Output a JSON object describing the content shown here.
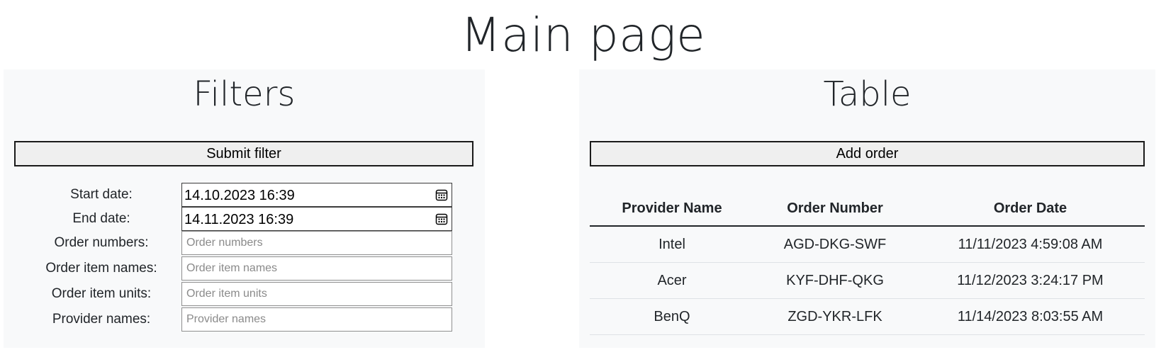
{
  "page": {
    "title": "Main page"
  },
  "filters": {
    "title": "Filters",
    "submit_label": "Submit filter",
    "start_date": {
      "label": "Start date:",
      "value": "14.10.2023 16:39"
    },
    "end_date": {
      "label": "End date:",
      "value": "14.11.2023 16:39"
    },
    "order_numbers": {
      "label": "Order numbers:",
      "placeholder": "Order numbers"
    },
    "order_item_names": {
      "label": "Order item names:",
      "placeholder": "Order item names"
    },
    "order_item_units": {
      "label": "Order item units:",
      "placeholder": "Order item units"
    },
    "provider_names": {
      "label": "Provider names:",
      "placeholder": "Provider names"
    },
    "date_icon": "calendar-icon"
  },
  "table": {
    "title": "Table",
    "add_label": "Add order",
    "columns": [
      "Provider Name",
      "Order Number",
      "Order Date"
    ],
    "rows": [
      [
        "Intel",
        "AGD-DKG-SWF",
        "11/11/2023 4:59:08 AM"
      ],
      [
        "Acer",
        "KYF-DHF-QKG",
        "11/12/2023 3:24:17 PM"
      ],
      [
        "BenQ",
        "ZGD-YKR-LFK",
        "11/14/2023 8:03:55 AM"
      ]
    ]
  },
  "colors": {
    "panel_background": "#f8f9fa",
    "button_background": "#efefef",
    "text": "#212529"
  }
}
